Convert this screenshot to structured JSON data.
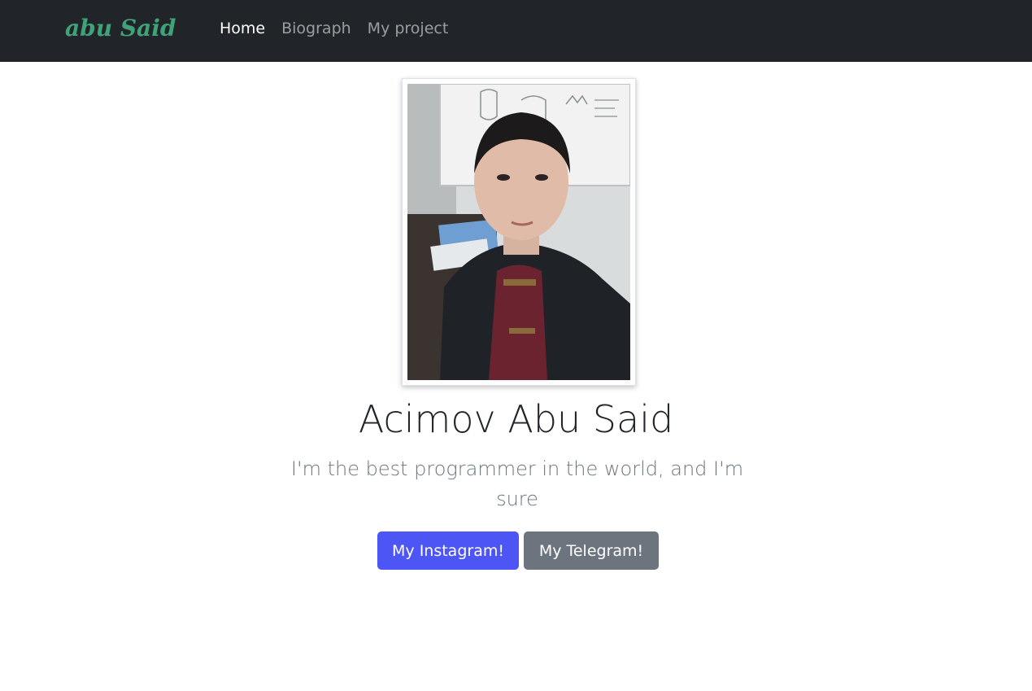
{
  "navbar": {
    "brand": "abu Said",
    "links": [
      {
        "label": "Home",
        "active": true
      },
      {
        "label": "Biograph",
        "active": false
      },
      {
        "label": "My project",
        "active": false
      }
    ]
  },
  "hero": {
    "name": "Acimov Abu Said",
    "tagline": "I'm the best programmer in the world, and I'm sure",
    "buttons": {
      "instagram": "My Instagram!",
      "telegram": "My Telegram!"
    }
  },
  "colors": {
    "navbar_bg": "#212529",
    "brand": "#3fa37a",
    "primary": "#4e55f5",
    "secondary": "#6c757d"
  }
}
